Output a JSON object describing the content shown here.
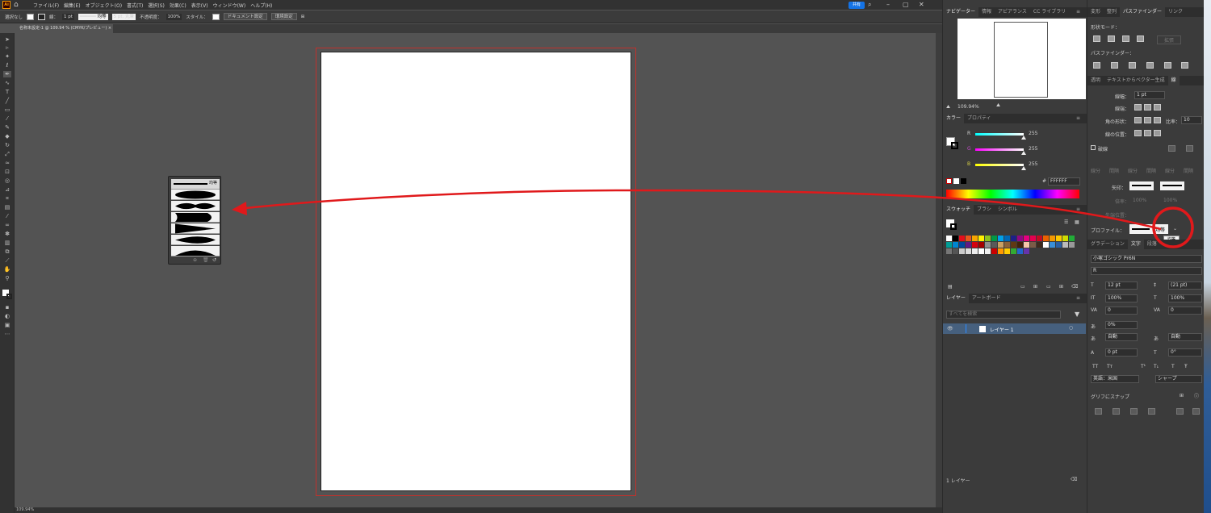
{
  "app": {
    "logo": "Ai",
    "menus": [
      "ファイル(F)",
      "編集(E)",
      "オブジェクト(O)",
      "書式(T)",
      "選択(S)",
      "効果(C)",
      "表示(V)",
      "ウィンドウ(W)",
      "ヘルプ(H)"
    ],
    "share": "共有"
  },
  "control": {
    "selection": "選択なし",
    "stroke_label": "線：",
    "stroke_value": "1 pt",
    "profile_label": "均等",
    "brush": "5 pt. 丸筆",
    "opacity_label": "不透明度：",
    "opacity_value": "100%",
    "style_label": "スタイル：",
    "doc_setup": "ドキュメント設定",
    "prefs": "環境設定"
  },
  "document": {
    "tab": "名称未設定-1 @ 109.94 % (CMYK/プレビュー)",
    "status_zoom": "109.94%"
  },
  "profile_popup": {
    "top_label": "均等"
  },
  "navigator": {
    "tabs": [
      "ナビゲーター",
      "情報",
      "アピアランス",
      "CC ライブラリ"
    ],
    "zoom": "109.94%"
  },
  "color": {
    "tabs": [
      "カラー",
      "プロパティ"
    ],
    "r_label": "R",
    "g_label": "G",
    "b_label": "B",
    "r": "255",
    "g": "255",
    "b": "255",
    "hex": "FFFFFF"
  },
  "swatches": {
    "tabs": [
      "スウォッチ",
      "ブラシ",
      "シンボル"
    ]
  },
  "layers": {
    "tabs": [
      "レイヤー",
      "アートボード"
    ],
    "search_placeholder": "すべてを検索",
    "layer_name": "レイヤー 1",
    "count": "1 レイヤー"
  },
  "pathfinder": {
    "tabs": [
      "変形",
      "整列",
      "パスファインダー",
      "リンク"
    ],
    "shape_modes": "形状モード：",
    "expand": "拡張",
    "pathfinders": "パスファインダー："
  },
  "stroke": {
    "tabs": [
      "透明",
      "テキストからベクター生成",
      "線"
    ],
    "weight_label": "線幅：",
    "weight": "1 pt",
    "cap_label": "線端：",
    "corner_label": "角の形状：",
    "limit_label": "比率：",
    "limit": "10",
    "align_label": "線の位置：",
    "dashed_label": "破線",
    "dash_cells": [
      "線分",
      "間隔",
      "線分",
      "間隔",
      "線分",
      "間隔"
    ],
    "arrow_label": "矢印：",
    "scale_label": "倍率：",
    "scale1": "100%",
    "scale2": "100%",
    "align_arrow_label": "先端位置：",
    "profile_label": "プロファイル：",
    "profile_value": "均等",
    "tooltip": "均等"
  },
  "character": {
    "tabs": [
      "グラデーション",
      "文字",
      "段落"
    ],
    "font": "小塚ゴシック Pr6N",
    "style": "R",
    "size": "12 pt",
    "leading": "(21 pt)",
    "vscale": "100%",
    "hscale": "100%",
    "kerning": "0",
    "tracking": "0",
    "tsume": "0%",
    "aki1": "自動",
    "aki2": "自動",
    "baseline": "0 pt",
    "rotation": "0°",
    "language": "英語：米国",
    "antialias": "シャープ",
    "snap": "グリフにスナップ"
  },
  "colors": {
    "accent": "#1473e6",
    "annotation": "#e0191b",
    "artboard_border": "#c0312c",
    "layer_select": "#46607e"
  }
}
